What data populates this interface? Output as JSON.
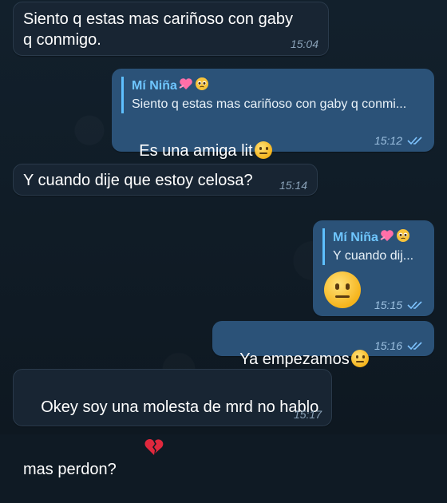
{
  "colors": {
    "background": "#0f1a24",
    "incoming_bubble": "#182533",
    "outgoing_bubble": "#2b5278",
    "reply_accent": "#5ec0ff",
    "read_check": "#7fc4ff"
  },
  "messages": [
    {
      "direction": "in",
      "text": "Siento q estas mas cariñoso con gaby\nq conmigo.",
      "time": "15:04"
    },
    {
      "direction": "out",
      "reply_name": "Mí Niña",
      "reply_text": "Siento q estas mas cariñoso con gaby q conmi...",
      "text": "Es una amiga lit",
      "emoji": "neutral-face",
      "time": "15:12",
      "status": "read"
    },
    {
      "direction": "in",
      "text": "Y cuando dije que estoy celosa?",
      "time": "15:14"
    },
    {
      "direction": "out",
      "reply_name": "Mí Niña",
      "reply_text": "Y cuando dij...",
      "emoji": "neutral-face",
      "time": "15:15",
      "status": "read"
    },
    {
      "direction": "out",
      "text": "Ya empezamos",
      "emoji": "neutral-face",
      "time": "15:16",
      "status": "read"
    },
    {
      "direction": "in",
      "text": "Okey soy una molesta de mrd no hablo\nmas perdon?",
      "emoji": "broken-heart",
      "time": "15:17"
    }
  ]
}
